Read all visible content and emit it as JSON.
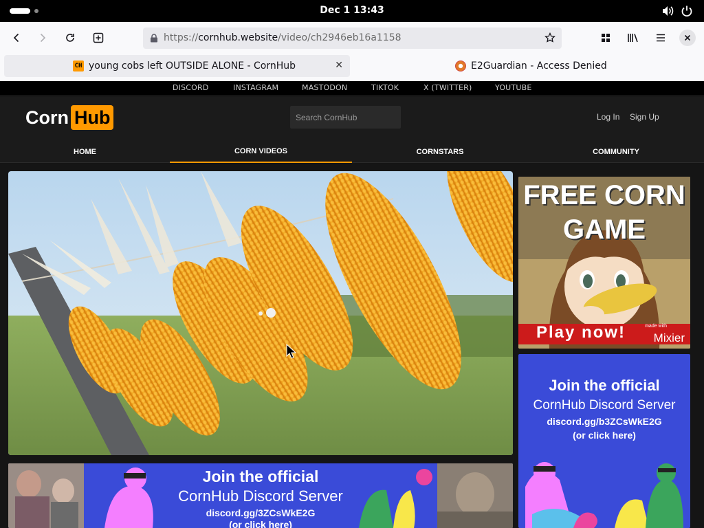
{
  "system": {
    "clock": "Dec 1  13:43"
  },
  "browser": {
    "url_prefix": "https://",
    "url_domain": "cornhub.website",
    "url_path": "/video/ch2946eb16a1158",
    "tabs": [
      {
        "title": "young cobs left OUTSIDE ALONE - CornHub",
        "favicon": "CH"
      },
      {
        "title": "E2Guardian - Access Denied"
      }
    ]
  },
  "site": {
    "social_links": [
      "DISCORD",
      "INSTAGRAM",
      "MASTODON",
      "TIKTOK",
      "X (TWITTER)",
      "YOUTUBE"
    ],
    "logo": {
      "part1": "Corn",
      "part2": "Hub"
    },
    "search_placeholder": "Search CornHub",
    "auth": {
      "login": "Log In",
      "signup": "Sign Up"
    },
    "nav": [
      "HOME",
      "CORN VIDEOS",
      "CORNSTARS",
      "COMMUNITY"
    ],
    "active_nav": "CORN VIDEOS"
  },
  "ads": {
    "game": {
      "line1": "FREE CORN",
      "line2": "GAME",
      "cta": "Play now!",
      "brand": "Mixier",
      "brand_tag": "made with"
    },
    "discord_side": {
      "line1": "Join the official",
      "line2": "CornHub Discord Server",
      "line3": "discord.gg/b3ZCsWkE2G",
      "line4": "(or click here)"
    },
    "discord_banner": {
      "line1": "Join the official",
      "line2": "CornHub Discord Server",
      "line3": "discord.gg/3ZCsWkE2G",
      "line4": "(or click here)"
    }
  },
  "colors": {
    "accent": "#ff9900",
    "discord_blue": "#3a4bd8",
    "page_bg": "#151515"
  }
}
